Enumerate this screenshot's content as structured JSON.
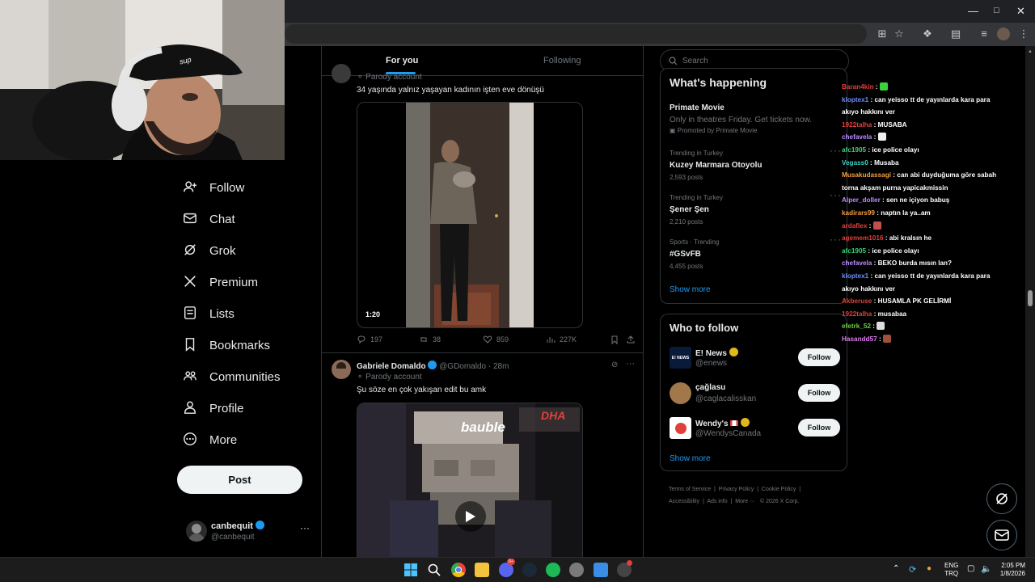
{
  "nav": {
    "items": [
      {
        "label": "Follow",
        "icon": "follow-icon"
      },
      {
        "label": "Chat",
        "icon": "mail-icon"
      },
      {
        "label": "Grok",
        "icon": "grok-icon"
      },
      {
        "label": "Premium",
        "icon": "x-logo-icon"
      },
      {
        "label": "Lists",
        "icon": "list-icon"
      },
      {
        "label": "Bookmarks",
        "icon": "bookmark-icon"
      },
      {
        "label": "Communities",
        "icon": "communities-icon"
      },
      {
        "label": "Profile",
        "icon": "person-icon"
      },
      {
        "label": "More",
        "icon": "more-circle-icon"
      }
    ],
    "post_label": "Post",
    "account": {
      "name": "canbequit",
      "handle": "@canbequit"
    }
  },
  "tabs": {
    "for_you": "For you",
    "following": "Following"
  },
  "tweet1": {
    "parody": "Parody account",
    "text": "34 yaşında yalnız yaşayan kadının işten eve dönüşü",
    "video_time": "1:20",
    "replies": "197",
    "reposts": "38",
    "likes": "859",
    "views": "227K"
  },
  "tweet2": {
    "name": "Gabriele Domaldo",
    "handle": "@GDomaldo",
    "time": "· 28m",
    "parody": "Parody account",
    "text": "Şu söze en çok yakışan edit bu amk",
    "media_caption": "bauble",
    "media_logo": "DHA"
  },
  "search": {
    "placeholder": "Search"
  },
  "happening": {
    "title": "What's happening",
    "promo": {
      "title": "Primate Movie",
      "desc": "Only in theatres Friday. Get tickets now.",
      "promoted": "Promoted by Primate Movie"
    },
    "trends": [
      {
        "context": "Trending in Turkey",
        "name": "Kuzey Marmara Otoyolu",
        "posts": "2,593 posts"
      },
      {
        "context": "Trending in Turkey",
        "name": "Şener Şen",
        "posts": "2,210 posts"
      },
      {
        "context": "Sports · Trending",
        "name": "#GSvFB",
        "posts": "4,455 posts"
      }
    ],
    "show_more": "Show more"
  },
  "who_to_follow": {
    "title": "Who to follow",
    "accounts": [
      {
        "name": "E! News",
        "handle": "@enews",
        "avatar_text": "E! NEWS"
      },
      {
        "name": "çağlasu",
        "handle": "@caglacalisskan",
        "avatar_text": ""
      },
      {
        "name": "Wendy's",
        "handle": "@WendysCanada",
        "avatar_text": ""
      }
    ],
    "follow_label": "Follow",
    "show_more": "Show more"
  },
  "footer": {
    "links": [
      "Terms of Service",
      "Privacy Policy",
      "Cookie Policy",
      "Accessibility",
      "Ads info",
      "More ···"
    ],
    "copyright": "© 2026 X Corp."
  },
  "chat": [
    {
      "user": "Baran4kin",
      "color": "#e0403a",
      "msg": ""
    },
    {
      "user": "kloptex1",
      "color": "#6b8cff",
      "msg": "can yeisso tt de yayınlarda kara para akıyo hakkını ver"
    },
    {
      "user": "1922talha",
      "color": "#e0403a",
      "msg": "MUSABA"
    },
    {
      "user": "chefavela",
      "color": "#b98cff",
      "msg": ""
    },
    {
      "user": "afc1905",
      "color": "#3ad17a",
      "msg": "ice police olayı"
    },
    {
      "user": "Vegass0",
      "color": "#3ad1c4",
      "msg": "Musaba"
    },
    {
      "user": "Musakudassagi",
      "color": "#f0a040",
      "msg": "can abi duyduğuma göre sabah torna akşam purna yapicakmissin"
    },
    {
      "user": "Alper_doller",
      "color": "#b98cff",
      "msg": "sen ne içiyon babuş"
    },
    {
      "user": "kadirars99",
      "color": "#f0a040",
      "msg": "naptın la ya..am"
    },
    {
      "user": "ardaflex",
      "color": "#e0403a",
      "msg": ""
    },
    {
      "user": "agemem1016",
      "color": "#e0403a",
      "msg": "abi kralsın he"
    },
    {
      "user": "afc1905",
      "color": "#3ad17a",
      "msg": "ice police olayı"
    },
    {
      "user": "chefavela",
      "color": "#b98cff",
      "msg": "BEKO burda mısın lan?"
    },
    {
      "user": "kloptex1",
      "color": "#6b8cff",
      "msg": "can yeisso tt de yayınlarda kara para akıyo hakkını ver"
    },
    {
      "user": "Akberuse",
      "color": "#e0403a",
      "msg": "HUSAMLA PK GELİRMİ"
    },
    {
      "user": "1922talha",
      "color": "#e0403a",
      "msg": "musabaa"
    },
    {
      "user": "efetrk_52",
      "color": "#6bd13a",
      "msg": ""
    },
    {
      "user": "Hasandd57",
      "color": "#e07af0",
      "msg": ""
    }
  ],
  "taskbar": {
    "lang_top": "ENG",
    "lang_bottom": "TRQ",
    "time": "2:05 PM",
    "date": "1/8/2026",
    "discord_badge": "9+"
  },
  "webcam": {
    "cap_text": "sup"
  },
  "colors": {
    "accent": "#1d9bf0",
    "background": "#000000",
    "tab_indicator": "#1d9bf0"
  }
}
